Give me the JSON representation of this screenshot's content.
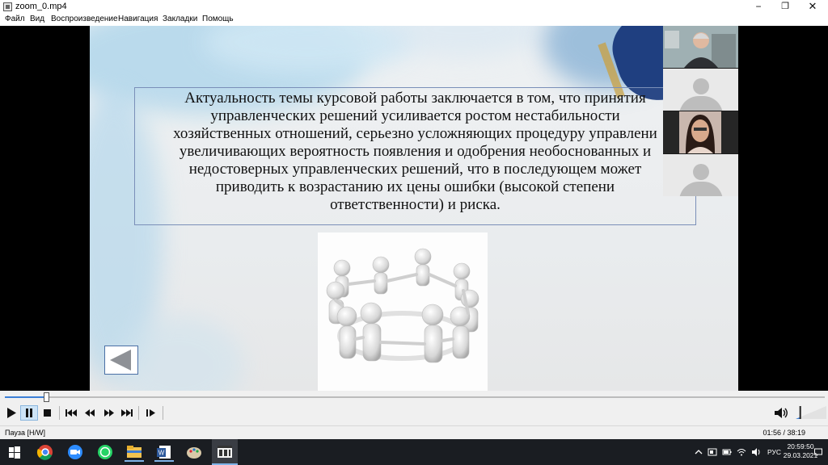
{
  "window": {
    "title": "zoom_0.mp4",
    "minimize_glyph": "−",
    "maximize_glyph": "❐",
    "close_glyph": "✕"
  },
  "menu": {
    "items": [
      "Файл",
      "Вид",
      "Воспроизведение",
      "Навигация",
      "Закладки",
      "Помощь"
    ]
  },
  "slide": {
    "text": "Актуальность темы курсовой работы заключается в том, что принятия\nуправленческих решений усиливается ростом нестабильности\nхозяйственных отношений, серьезно усложняющих процедуру управлени\nувеличивающих вероятность появления и одобрения необоснованных и\nнедостоверных управленческих решений, что в последующем может\nприводить к возрастанию их цены ошибки (высокой степени\nответственности) и риска."
  },
  "participants": {
    "icons": [
      "participant-video-1",
      "participant-avatar",
      "participant-video-2",
      "participant-avatar"
    ]
  },
  "playback": {
    "progress_fraction": 0.05,
    "volume_fraction": 0.15
  },
  "status": {
    "state": "Пауза [H/W]",
    "time": "01:56 / 38:19"
  },
  "taskbar": {
    "language": "РУС",
    "clock_time": "20:59:50",
    "clock_date": "29.03.2021"
  },
  "colors": {
    "accent": "#3c7fd6",
    "taskbar": "#1a1d22",
    "slide_border": "#7a8fb8"
  }
}
